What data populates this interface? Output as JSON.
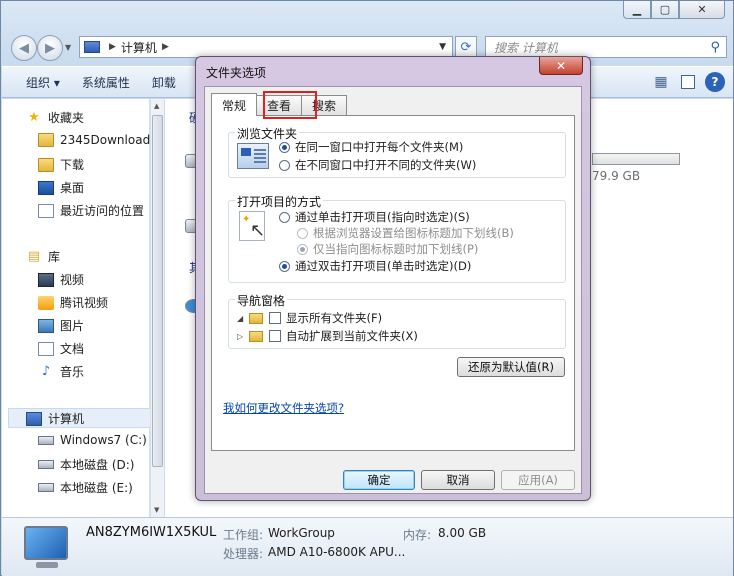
{
  "explorer": {
    "search_placeholder": "搜索 计算机",
    "breadcrumb": [
      "计算机"
    ],
    "toolbar": [
      "组织 ▾",
      "系统属性",
      "卸载"
    ],
    "sidebar": {
      "favorites": {
        "label": "收藏夹",
        "items": [
          "2345Downloads",
          "下载",
          "桌面",
          "最近访问的位置"
        ]
      },
      "libraries": {
        "label": "库",
        "items": [
          "视频",
          "腾讯视频",
          "图片",
          "文档",
          "音乐"
        ]
      },
      "computer": {
        "label": "计算机",
        "items": [
          "Windows7 (C:)",
          "本地磁盘 (D:)",
          "本地磁盘 (E:)"
        ]
      }
    },
    "content": {
      "group1_label": "硬",
      "group2_label": "其",
      "free_space": "79.9 GB"
    },
    "details": {
      "computer_name": "AN8ZYM6IW1X5KUL",
      "workgroup_label": "工作组:",
      "workgroup_value": "WorkGroup",
      "memory_label": "内存:",
      "memory_value": "8.00 GB",
      "cpu_label": "处理器:",
      "cpu_value": "AMD A10-6800K APU..."
    }
  },
  "dialog": {
    "title": "文件夹选项",
    "close_glyph": "✕",
    "tabs": [
      "常规",
      "查看",
      "搜索"
    ],
    "active_tab": "常规",
    "browse": {
      "legend": "浏览文件夹",
      "options": [
        "在同一窗口中打开每个文件夹(M)",
        "在不同窗口中打开不同的文件夹(W)"
      ],
      "selected": 0
    },
    "click": {
      "legend": "打开项目的方式",
      "single": "通过单击打开项目(指向时选定)(S)",
      "sub1": "根据浏览器设置给图标标题加下划线(B)",
      "sub2": "仅当指向图标标题时加下划线(P)",
      "double": "通过双击打开项目(单击时选定)(D)"
    },
    "nav": {
      "legend": "导航窗格",
      "show_all": "显示所有文件夹(F)",
      "auto_expand": "自动扩展到当前文件夹(X)"
    },
    "restore_label": "还原为默认值(R)",
    "help_link": "我如何更改文件夹选项?",
    "ok_label": "确定",
    "cancel_label": "取消",
    "apply_label": "应用(A)"
  }
}
